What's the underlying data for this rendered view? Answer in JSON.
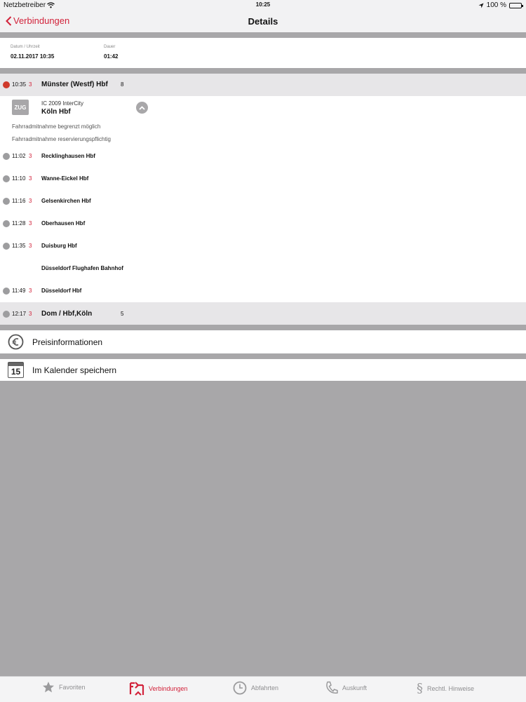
{
  "status_bar": {
    "carrier": "Netzbetreiber",
    "time": "10:25",
    "battery": "100 %"
  },
  "nav": {
    "back_label": "Verbindungen",
    "title": "Details"
  },
  "summary": {
    "date_label": "Datum / Uhrzeit",
    "date_value": "02.11.2017 10:35",
    "duration_label": "Dauer",
    "duration_value": "01:42"
  },
  "departure": {
    "time": "10:35",
    "track": "3",
    "station": "Münster (Westf) Hbf",
    "platform": "8"
  },
  "train": {
    "badge": "ZUG",
    "line": "IC 2009 InterCity",
    "destination": "Köln Hbf"
  },
  "notes": [
    "Fahrradmitnahme begrenzt möglich",
    "Fahrradmitnahme reservierungspflichtig"
  ],
  "stops": [
    {
      "time": "11:02",
      "track": "3",
      "station": "Recklinghausen Hbf"
    },
    {
      "time": "11:10",
      "track": "3",
      "station": "Wanne-Eickel Hbf"
    },
    {
      "time": "11:16",
      "track": "3",
      "station": "Gelsenkirchen Hbf"
    },
    {
      "time": "11:28",
      "track": "3",
      "station": "Oberhausen Hbf"
    },
    {
      "time": "11:35",
      "track": "3",
      "station": "Duisburg Hbf"
    },
    {
      "time": "",
      "track": "",
      "station": "Düsseldorf Flughafen Bahnhof"
    },
    {
      "time": "11:49",
      "track": "3",
      "station": "Düsseldorf Hbf"
    }
  ],
  "arrival": {
    "time": "12:17",
    "track": "3",
    "station": "Dom / Hbf,Köln",
    "platform": "5"
  },
  "actions": {
    "price_label": "Preisinformationen",
    "calendar_label": "Im Kalender speichern",
    "calendar_day": "15"
  },
  "tabs": [
    {
      "label": "Favoriten"
    },
    {
      "label": "Verbindungen"
    },
    {
      "label": "Abfahrten"
    },
    {
      "label": "Auskunft"
    },
    {
      "label": "Rechtl. Hinweise"
    }
  ],
  "colors": {
    "accent": "#d2223a",
    "departure_dot": "#cf3a2c",
    "background": "#a8a7a9"
  }
}
